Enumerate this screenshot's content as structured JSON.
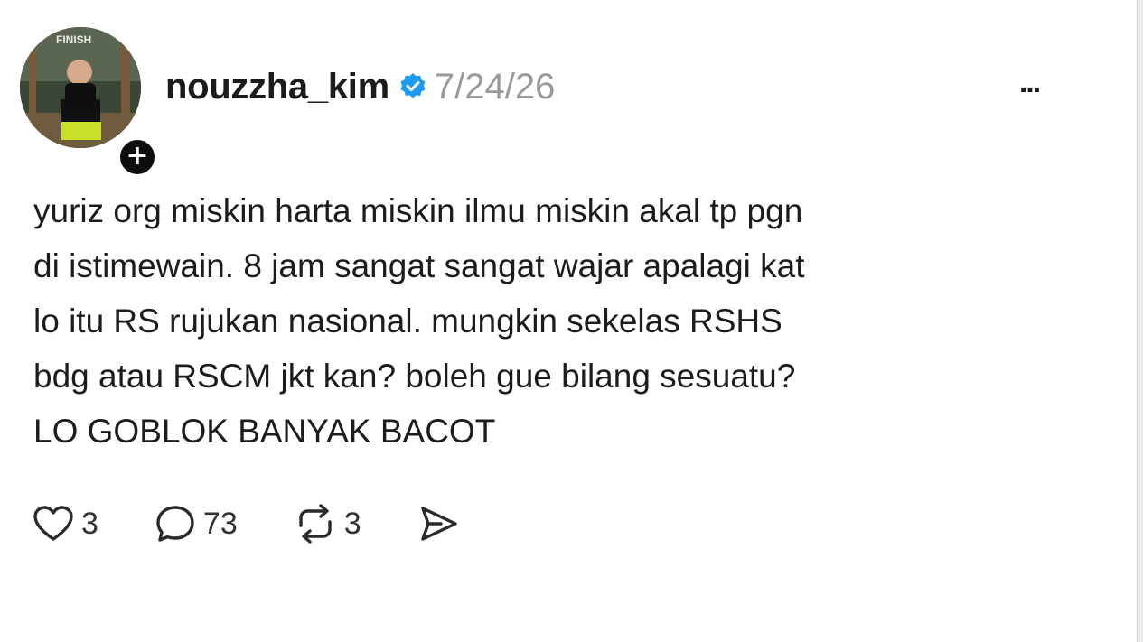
{
  "post": {
    "username": "nouzzha_kim",
    "timestamp": "7/24/26",
    "avatar_caption": "FINISH",
    "body_lines": [
      "yuriz org miskin harta miskin ilmu miskin akal tp pgn",
      "di istimewain. 8 jam sangat sangat wajar apalagi kat",
      "lo itu RS rujukan nasional. mungkin sekelas RSHS",
      "bdg atau RSCM jkt kan? boleh gue bilang sesuatu?",
      "LO GOBLOK BANYAK BACOT"
    ],
    "more_label": "...",
    "follow_label": "+"
  },
  "actions": {
    "likes": "3",
    "replies": "73",
    "reposts": "3"
  },
  "icons": {
    "verified": "verified-badge-icon",
    "like": "heart-icon",
    "reply": "speech-bubble-icon",
    "repost": "repost-icon",
    "share": "send-icon",
    "more": "more-horizontal-icon",
    "follow": "plus-icon"
  },
  "colors": {
    "verified": "#1d9bf0",
    "timestamp": "#9a9a9a",
    "text": "#1c1c1c"
  }
}
